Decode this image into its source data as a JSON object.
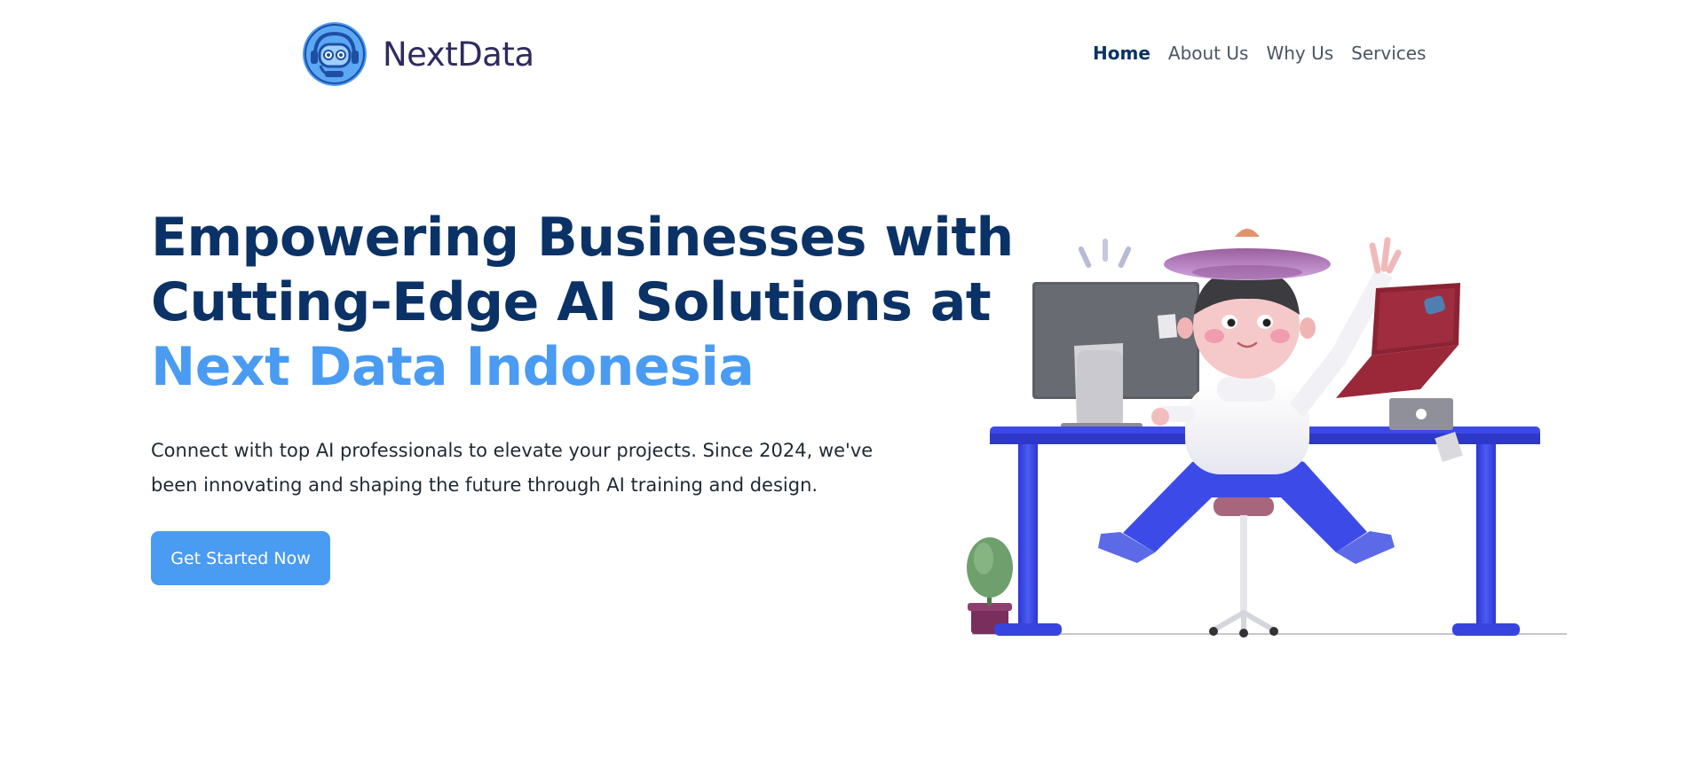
{
  "brand": {
    "name": "NextData",
    "logo_icon": "robot-headset-icon"
  },
  "nav": {
    "items": [
      {
        "label": "Home",
        "active": true
      },
      {
        "label": "About Us",
        "active": false
      },
      {
        "label": "Why Us",
        "active": false
      },
      {
        "label": "Services",
        "active": false
      }
    ]
  },
  "hero": {
    "headline_lines": [
      "Empowering Businesses with",
      "Cutting-Edge AI Solutions at"
    ],
    "headline_highlight": "Next Data Indonesia",
    "description": "Connect with top AI professionals to elevate your projects. Since 2024, we've been innovating and shaping the future through AI training and design.",
    "cta_label": "Get Started Now"
  },
  "colors": {
    "primary": "#0b3266",
    "accent": "#4a9bf2",
    "brand_text": "#2f2a5f",
    "desk": "#3d49e6"
  }
}
